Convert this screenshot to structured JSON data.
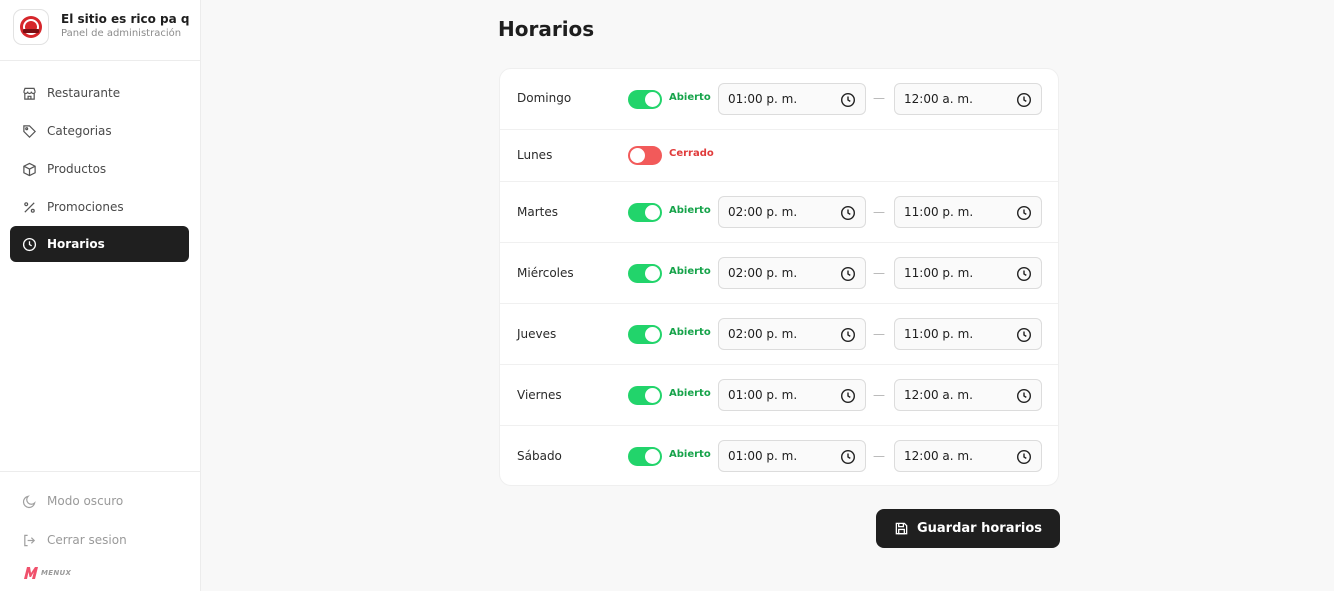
{
  "brand": {
    "name": "El sitio es rico pa q",
    "subtitle": "Panel de administración"
  },
  "sidebar": {
    "items": [
      {
        "label": "Restaurante",
        "icon": "store-icon"
      },
      {
        "label": "Categorias",
        "icon": "tag-icon"
      },
      {
        "label": "Productos",
        "icon": "box-icon"
      },
      {
        "label": "Promociones",
        "icon": "percent-icon"
      },
      {
        "label": "Horarios",
        "icon": "clock-icon",
        "active": true
      }
    ],
    "footer": {
      "dark_mode": "Modo oscuro",
      "logout": "Cerrar sesion",
      "logo_text": "MENUX"
    }
  },
  "main": {
    "title": "Horarios",
    "schedule": [
      {
        "day": "Domingo",
        "status": "Abierto",
        "open": true,
        "from": "01:00 p. m.",
        "to": "12:00 a. m."
      },
      {
        "day": "Lunes",
        "status": "Cerrado",
        "open": false
      },
      {
        "day": "Martes",
        "status": "Abierto",
        "open": true,
        "from": "02:00 p. m.",
        "to": "11:00 p. m."
      },
      {
        "day": "Miércoles",
        "status": "Abierto",
        "open": true,
        "from": "02:00 p. m.",
        "to": "11:00 p. m."
      },
      {
        "day": "Jueves",
        "status": "Abierto",
        "open": true,
        "from": "02:00 p. m.",
        "to": "11:00 p. m."
      },
      {
        "day": "Viernes",
        "status": "Abierto",
        "open": true,
        "from": "01:00 p. m.",
        "to": "12:00 a. m."
      },
      {
        "day": "Sábado",
        "status": "Abierto",
        "open": true,
        "from": "01:00 p. m.",
        "to": "12:00 a. m."
      }
    ],
    "separator": "—",
    "save_label": "Guardar horarios"
  },
  "colors": {
    "accent_dark": "#1f1f1f",
    "toggle_on": "#22d46b",
    "toggle_off": "#f25a5a",
    "status_open": "#16a34a",
    "status_closed": "#e03b3b"
  }
}
